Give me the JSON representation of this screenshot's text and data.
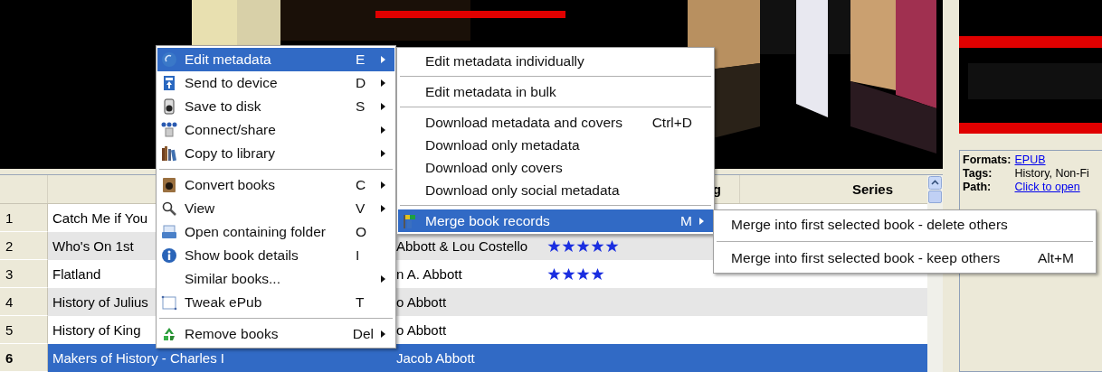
{
  "table": {
    "column_4": "g",
    "series": "Series",
    "rows": [
      {
        "number": "1",
        "title": "Catch Me if You",
        "selected": false
      },
      {
        "number": "2",
        "title": "Who's On 1st",
        "author": "Abbott & Lou Costello",
        "stars": 5,
        "selected": false
      },
      {
        "number": "3",
        "title": "Flatland",
        "author": "n A. Abbott",
        "stars": 4,
        "selected": false
      },
      {
        "number": "4",
        "title": "History of Julius",
        "author": "o Abbott",
        "selected": false
      },
      {
        "number": "5",
        "title": "History of King",
        "author": "o Abbott",
        "selected": false
      },
      {
        "number": "6",
        "title": "Makers of History - Charles I",
        "author": "Jacob Abbott",
        "selected": true
      }
    ]
  },
  "details": [
    {
      "label": "Formats:",
      "value": "EPUB",
      "kind": "link"
    },
    {
      "label": "Tags:",
      "value": "History, Non-Fi",
      "kind": "text"
    },
    {
      "label": "Path:",
      "value": "Click to open",
      "kind": "link"
    }
  ],
  "context_menu": [
    {
      "kind": "item",
      "label": "Edit metadata",
      "shortcut": "E",
      "submenu": true,
      "selected": true
    },
    {
      "kind": "item",
      "label": "Send to device",
      "shortcut": "D",
      "submenu": true,
      "selected": false
    },
    {
      "kind": "item",
      "label": "Save to disk",
      "shortcut": "S",
      "submenu": true,
      "selected": false
    },
    {
      "kind": "item",
      "label": "Connect/share",
      "submenu": true,
      "selected": false
    },
    {
      "kind": "item",
      "label": "Copy to library",
      "submenu": true,
      "selected": false
    },
    {
      "kind": "separator"
    },
    {
      "kind": "item",
      "label": "Convert books",
      "shortcut": "C",
      "submenu": true,
      "selected": false
    },
    {
      "kind": "item",
      "label": "View",
      "shortcut": "V",
      "submenu": true,
      "selected": false
    },
    {
      "kind": "item",
      "label": "Open containing folder",
      "shortcut": "O",
      "submenu": false,
      "selected": false
    },
    {
      "kind": "item",
      "label": "Show book details",
      "shortcut": "I",
      "submenu": false,
      "selected": false
    },
    {
      "kind": "item",
      "label": "Similar books...",
      "submenu": true,
      "selected": false
    },
    {
      "kind": "item",
      "label": "Tweak ePub",
      "shortcut": "T",
      "submenu": false,
      "selected": false
    },
    {
      "kind": "separator"
    },
    {
      "kind": "item",
      "label": "Remove books",
      "shortcut": "Del",
      "submenu": true,
      "selected": false
    }
  ],
  "metadata_submenu": [
    {
      "kind": "item",
      "label": "Edit metadata individually",
      "submenu": false,
      "selected": false
    },
    {
      "kind": "separator"
    },
    {
      "kind": "item",
      "label": "Edit metadata in bulk",
      "submenu": false,
      "selected": false
    },
    {
      "kind": "separator"
    },
    {
      "kind": "item",
      "label": "Download metadata and covers",
      "shortcut": "Ctrl+D",
      "submenu": false,
      "selected": false
    },
    {
      "kind": "item",
      "label": "Download only metadata",
      "submenu": false,
      "selected": false
    },
    {
      "kind": "item",
      "label": "Download only covers",
      "submenu": false,
      "selected": false
    },
    {
      "kind": "item",
      "label": "Download only social metadata",
      "submenu": false,
      "selected": false
    },
    {
      "kind": "separator"
    },
    {
      "kind": "item",
      "label": "Merge book records",
      "shortcut": "M",
      "submenu": true,
      "selected": true
    }
  ],
  "merge_submenu": [
    {
      "kind": "item",
      "label": "Merge into first selected book - delete others",
      "submenu": false,
      "selected": false
    },
    {
      "kind": "separator"
    },
    {
      "kind": "item",
      "label": "Merge into first selected book - keep others",
      "shortcut": "Alt+M",
      "submenu": false,
      "selected": false
    }
  ]
}
